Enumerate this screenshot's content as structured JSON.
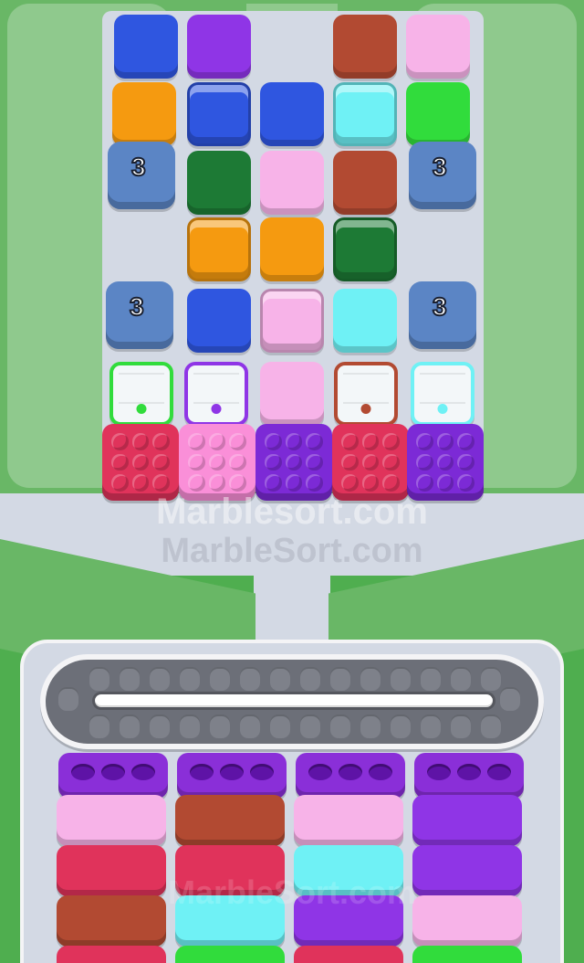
{
  "colors": {
    "blue": "#2f56e0",
    "purple": "#8f35e6",
    "brown": "#b24a32",
    "pink": "#f7b3e8",
    "orange": "#f59a10",
    "cyan": "#6ff1f5",
    "green": "#31dc3c",
    "darkgreen": "#1d7a35",
    "crimson": "#e0335b",
    "hotpink": "#fa8fd8",
    "violet": "#7c2ad6",
    "steel": "#5b85c5"
  },
  "board": {
    "tiles": [
      {
        "color": "blue"
      },
      {
        "color": "purple"
      },
      {
        "color": "brown"
      },
      {
        "color": "pink"
      },
      {
        "color": "orange"
      },
      {
        "color": "blue",
        "glossy": true
      },
      {
        "color": "blue"
      },
      {
        "color": "cyan",
        "glossy": true
      },
      {
        "color": "green"
      },
      {
        "color": "darkgreen"
      },
      {
        "color": "pink"
      },
      {
        "color": "brown"
      },
      {
        "color": "orange",
        "glossy": true
      },
      {
        "color": "orange"
      },
      {
        "color": "darkgreen",
        "glossy": true
      },
      {
        "color": "blue"
      },
      {
        "color": "pink",
        "glossy": true
      },
      {
        "color": "cyan"
      },
      {
        "color": "pink"
      }
    ],
    "counters": [
      "3",
      "3",
      "3",
      "3"
    ],
    "windows": [
      {
        "color": "green"
      },
      {
        "color": "purple"
      },
      {
        "color": "brown"
      },
      {
        "color": "cyan"
      }
    ],
    "marble_boxes": [
      {
        "color": "crimson"
      },
      {
        "color": "hotpink"
      },
      {
        "color": "violet"
      },
      {
        "color": "crimson"
      },
      {
        "color": "violet"
      }
    ]
  },
  "watermarks": [
    "Marblesort.com",
    "MarbleSort.com",
    "MarbleSort.com"
  ],
  "collector": {
    "columns": [
      {
        "pieces": [
          "pink",
          "crimson",
          "brown",
          "crimson"
        ]
      },
      {
        "pieces": [
          "brown",
          "crimson",
          "cyan",
          "green"
        ]
      },
      {
        "pieces": [
          "pink",
          "cyan",
          "purple",
          "crimson"
        ]
      },
      {
        "pieces": [
          "purple",
          "purple",
          "pink",
          "green"
        ]
      }
    ]
  }
}
